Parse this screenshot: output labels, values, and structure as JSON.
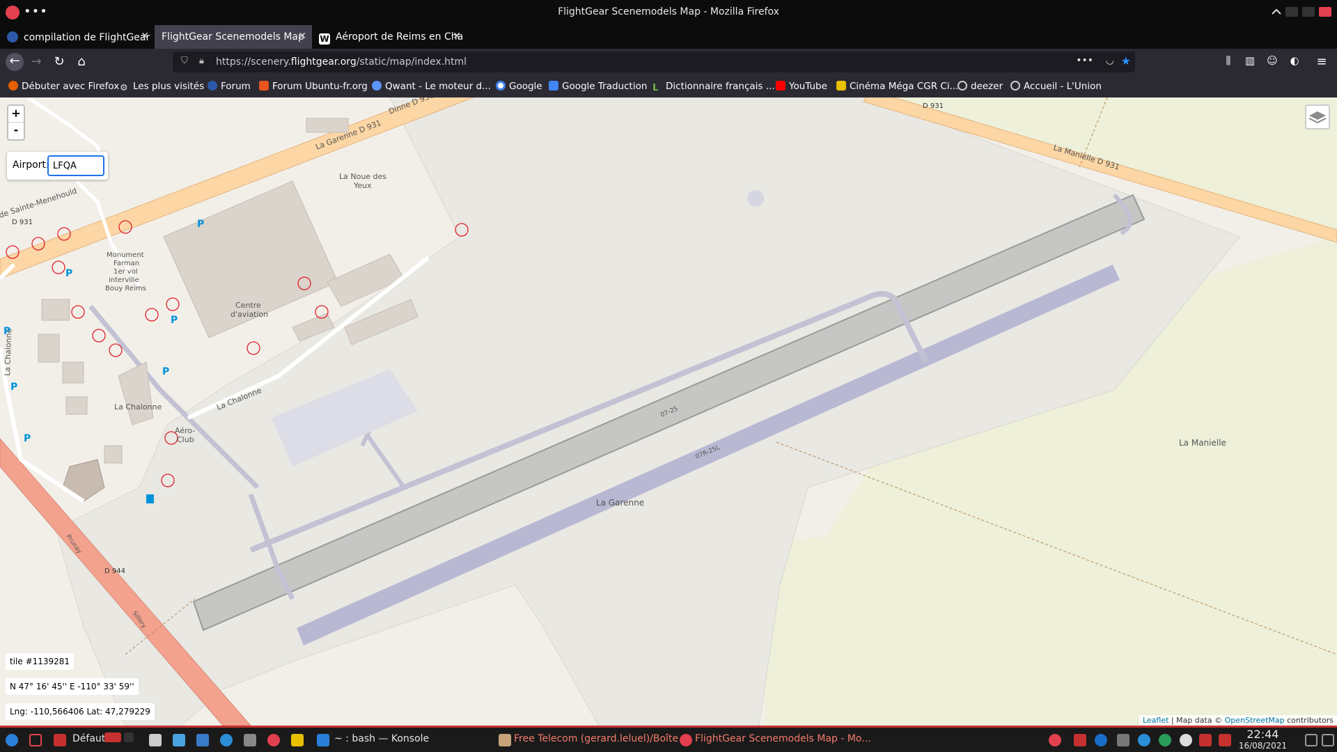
{
  "window": {
    "title": "FlightGear Scenemodels Map - Mozilla Firefox"
  },
  "tabs": [
    {
      "label": "compilation de FlightGear",
      "active": false
    },
    {
      "label": "FlightGear Scenemodels Map",
      "active": true
    },
    {
      "label": "Aéroport de Reims en Cha",
      "active": false
    }
  ],
  "url": {
    "prefix": "https://scenery.",
    "domain": "flightgear.org",
    "path": "/static/map/index.html"
  },
  "bookmarks": [
    "Débuter avec Firefox",
    "Les plus visités",
    "Forum",
    "Forum Ubuntu-fr.org",
    "Qwant - Le moteur d...",
    "Google",
    "Google Traduction",
    "Dictionnaire français ...",
    "YouTube",
    "Cinéma Méga CGR Ci...",
    "deezer",
    "Accueil - L'Union"
  ],
  "map": {
    "zoom_in": "+",
    "zoom_out": "-",
    "airport_label": "Airport:",
    "airport_value": "LFQA",
    "tile": "tile #1139281",
    "dms": "N 47° 16' 45'' E -110° 33' 59''",
    "lnglat": "Lng: -110,566406 Lat: 47,279229",
    "attribution": {
      "leaflet": "Leaflet",
      "sep": " | Map data © ",
      "osm": "OpenStreetMap",
      "suffix": " contributors"
    },
    "labels": {
      "garenne_road": "La Garenne D 931",
      "d931_a": "D 931",
      "d931_b": "D 931",
      "d931_c": "D 931",
      "manielle_road": "La Manielle D 931",
      "noue_1": "La Noue des",
      "noue_2": "Yeux",
      "centre_1": "Centre",
      "centre_2": "d'aviation",
      "chalonne_road": "La Chalonne",
      "chalonne_place": "La Chalonne",
      "chalonne_vertical": "La Chalonne",
      "aero_1": "Aéro-",
      "aero_2": "Club",
      "monument_1": "Monument",
      "monument_2": "Farman",
      "monument_3": "1er vol",
      "monument_4": "interville",
      "monument_5": "Bouy Reims",
      "menehould": "de Sainte-Menehould",
      "d944": "D 944",
      "prunay": "Prunay",
      "sillery": "Sillery",
      "garenne_place": "La Garenne",
      "manielle_place": "La Manielle",
      "rwy1": "07-25",
      "rwy2": "07R-25L",
      "dinne": "Dinne D 931",
      "parking": "P"
    }
  },
  "taskbar": {
    "profile": "Défaut",
    "konsole": "~ : bash — Konsole",
    "mail": "Free Telecom (gerard.leluel)/Boîte ...",
    "firefox": "FlightGear Scenemodels Map - Mo...",
    "time": "22:44",
    "date": "16/08/2021"
  }
}
